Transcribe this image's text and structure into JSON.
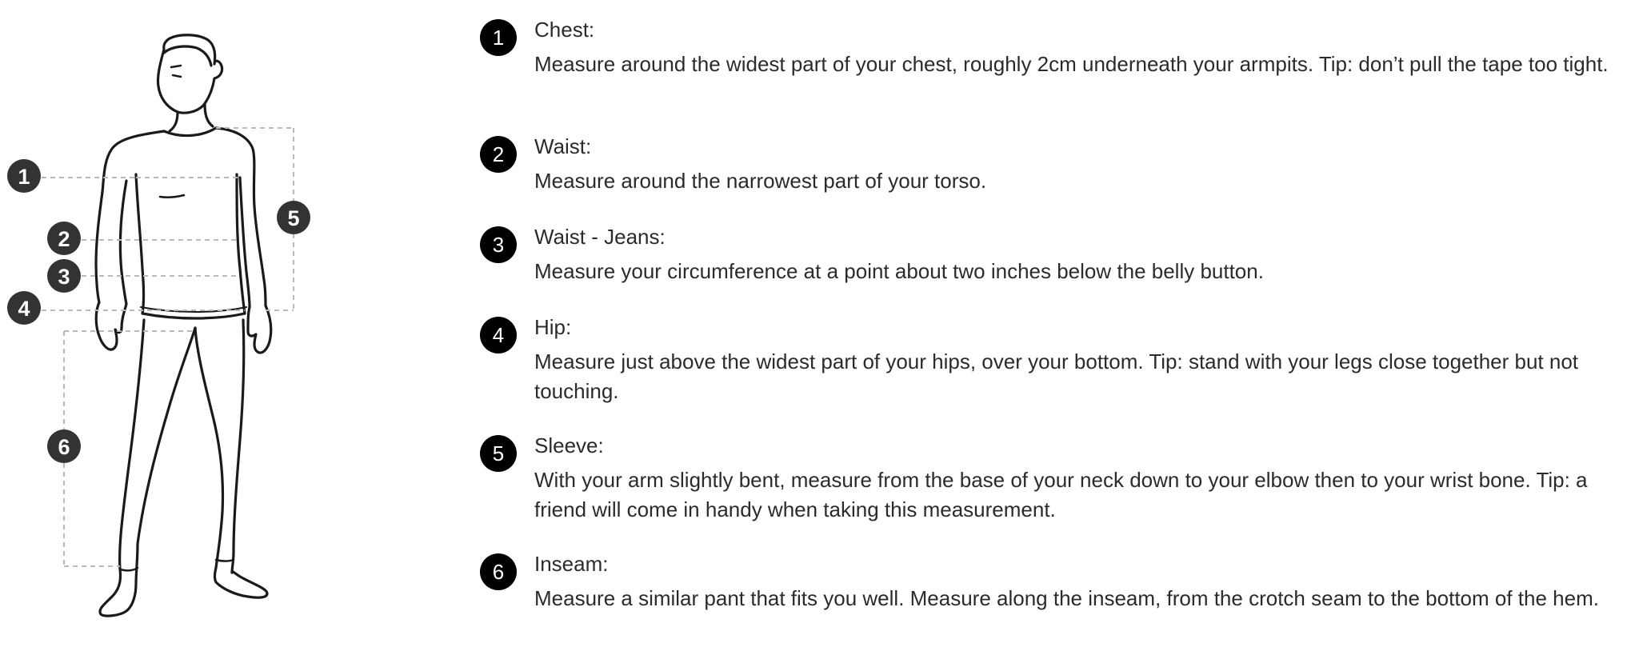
{
  "figure": {
    "markers": [
      {
        "id": "1",
        "label": "1"
      },
      {
        "id": "2",
        "label": "2"
      },
      {
        "id": "3",
        "label": "3"
      },
      {
        "id": "4",
        "label": "4"
      },
      {
        "id": "5",
        "label": "5"
      },
      {
        "id": "6",
        "label": "6"
      }
    ]
  },
  "colors": {
    "marker_fill": "#333333",
    "text": "#2b2b2b",
    "number_badge": "#000000",
    "guide_line": "#b9b9b9"
  },
  "guide": {
    "items": [
      {
        "number": "1",
        "title": "Chest:",
        "description": "Measure around the widest part of your chest, roughly 2cm underneath your armpits. Tip: don’t pull the tape too tight."
      },
      {
        "number": "2",
        "title": "Waist:",
        "description": "Measure around the narrowest part of your torso."
      },
      {
        "number": "3",
        "title": "Waist - Jeans:",
        "description": "Measure your circumference at a point about two inches below the belly button."
      },
      {
        "number": "4",
        "title": "Hip:",
        "description": "Measure just above the widest part of your hips, over your bottom. Tip: stand with your legs close together but not touching."
      },
      {
        "number": "5",
        "title": "Sleeve:",
        "description": "With your arm slightly bent, measure from the base of your neck down to your elbow then to your wrist bone. Tip: a friend will come in handy when taking this measurement."
      },
      {
        "number": "6",
        "title": "Inseam:",
        "description": "Measure a similar pant that fits you well. Measure along the inseam, from the crotch seam to the bottom of the hem."
      }
    ]
  }
}
